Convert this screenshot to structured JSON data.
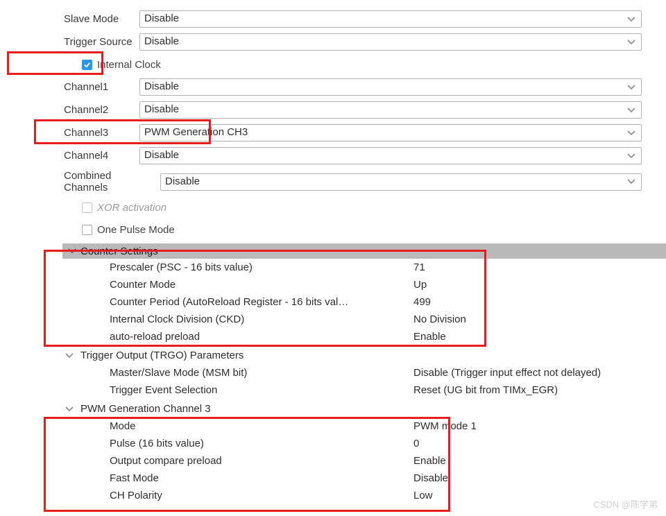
{
  "labels": {
    "slave_mode": "Slave Mode",
    "trigger_source": "Trigger Source",
    "internal_clock": "Internal Clock",
    "channel1": "Channel1",
    "channel2": "Channel2",
    "channel3": "Channel3",
    "channel4": "Channel4",
    "combined_channels": "Combined Channels",
    "xor_activation": "XOR activation",
    "one_pulse_mode": "One Pulse Mode"
  },
  "values": {
    "slave_mode": "Disable",
    "trigger_source": "Disable",
    "internal_clock_checked": true,
    "channel1": "Disable",
    "channel2": "Disable",
    "channel3": "PWM Generation CH3",
    "channel4": "Disable",
    "combined_channels": "Disable",
    "xor_checked": false,
    "one_pulse_checked": false
  },
  "sections": {
    "counter_settings": "Counter Settings",
    "trgo": "Trigger Output (TRGO) Parameters",
    "pwm_ch3": "PWM Generation Channel 3"
  },
  "counter_settings": {
    "prescaler_label": "Prescaler (PSC - 16 bits value)",
    "prescaler_value": "71",
    "counter_mode_label": "Counter Mode",
    "counter_mode_value": "Up",
    "counter_period_label": "Counter Period (AutoReload Register - 16 bits val…",
    "counter_period_value": "499",
    "ckd_label": "Internal Clock Division (CKD)",
    "ckd_value": "No Division",
    "arpe_label": "auto-reload preload",
    "arpe_value": "Enable"
  },
  "trgo": {
    "msm_label": "Master/Slave Mode (MSM bit)",
    "msm_value": "Disable (Trigger input effect not delayed)",
    "tes_label": "Trigger Event Selection",
    "tes_value": "Reset (UG bit from TIMx_EGR)"
  },
  "pwm_ch3": {
    "mode_label": "Mode",
    "mode_value": "PWM mode 1",
    "pulse_label": "Pulse (16 bits value)",
    "pulse_value": "0",
    "ocp_label": "Output compare preload",
    "ocp_value": "Enable",
    "fast_label": "Fast Mode",
    "fast_value": "Disable",
    "pol_label": "CH Polarity",
    "pol_value": "Low"
  },
  "watermark": "CSDN @陈学弟"
}
